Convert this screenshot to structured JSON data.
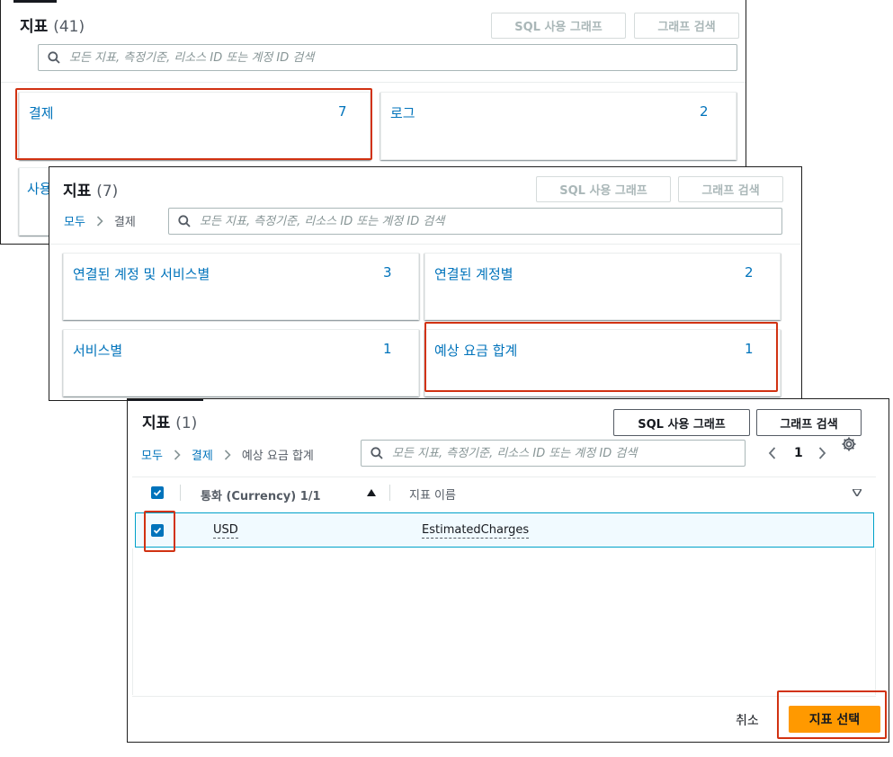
{
  "panel1": {
    "title": "지표",
    "count": "(41)",
    "btn_sql": "SQL 사용 그래프",
    "btn_search": "그래프 검색",
    "search_placeholder": "모든 지표, 측정기준, 리소스 ID 또는 계정 ID 검색",
    "cards": [
      {
        "label": "결제",
        "count": "7"
      },
      {
        "label": "로그",
        "count": "2"
      },
      {
        "label": "사용",
        "count": ""
      }
    ]
  },
  "panel2": {
    "title": "지표",
    "count": "(7)",
    "btn_sql": "SQL 사용 그래프",
    "btn_search": "그래프 검색",
    "breadcrumb": {
      "root": "모두",
      "current": "결제"
    },
    "search_placeholder": "모든 지표, 측정기준, 리소스 ID 또는 계정 ID 검색",
    "cards": [
      {
        "label": "연결된 계정 및 서비스별",
        "count": "3"
      },
      {
        "label": "연결된 계정별",
        "count": "2"
      },
      {
        "label": "서비스별",
        "count": "1"
      },
      {
        "label": "예상 요금 합계",
        "count": "1"
      }
    ]
  },
  "panel3": {
    "title": "지표",
    "count": "(1)",
    "btn_sql": "SQL 사용 그래프",
    "btn_search": "그래프 검색",
    "breadcrumb": {
      "root": "모두",
      "mid": "결제",
      "current": "예상 요금 합계"
    },
    "search_placeholder": "모든 지표, 측정기준, 리소스 ID 또는 계정 ID 검색",
    "page_number": "1",
    "table": {
      "columns": [
        "통화 (Currency) 1/1",
        "지표 이름"
      ],
      "rows": [
        {
          "currency": "USD",
          "metric": "EstimatedCharges",
          "checked": true
        }
      ]
    },
    "cancel_label": "취소",
    "select_label": "지표 선택"
  },
  "colors": {
    "link": "#0073bb",
    "primary": "#ff9900",
    "highlight": "#d13212",
    "selected_row": "#f1faff"
  },
  "icons": [
    "search-icon",
    "chevron-right-icon",
    "chevron-left-icon",
    "gear-icon",
    "sort-up-icon",
    "sort-down-icon",
    "check-icon"
  ]
}
